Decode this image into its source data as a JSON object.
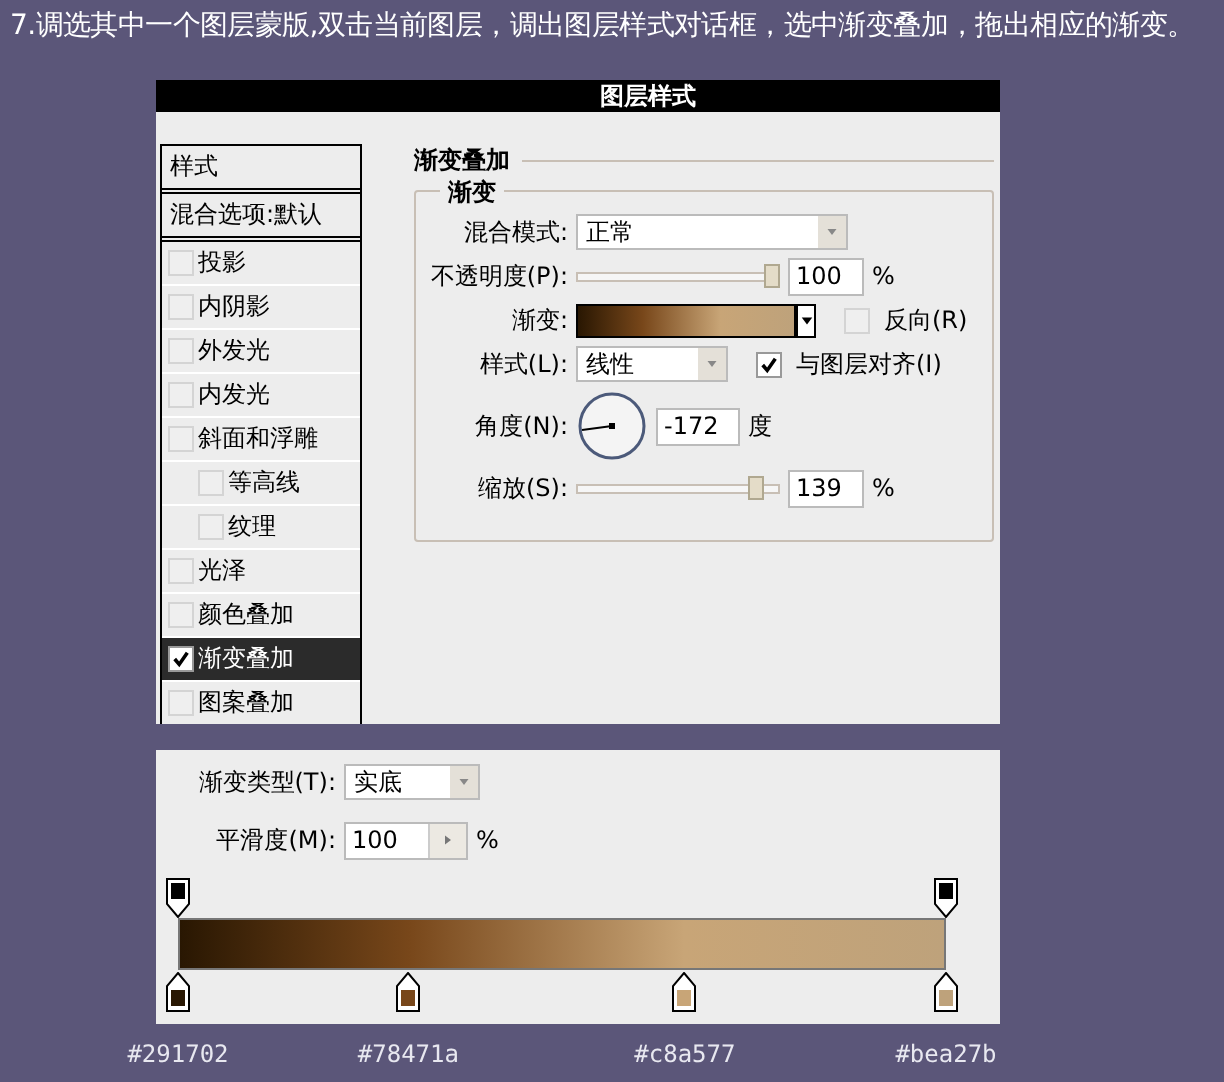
{
  "caption": "7.调选其中一个图层蒙版,双击当前图层，调出图层样式对话框，选中渐变叠加，拖出相应的渐变。",
  "dialog": {
    "title": "图层样式",
    "styles_list": [
      {
        "kind": "header",
        "label": "样式",
        "selected": false
      },
      {
        "kind": "header",
        "label": "混合选项:默认",
        "selected": false
      },
      {
        "kind": "check",
        "label": "投影",
        "checked": false,
        "selected": false
      },
      {
        "kind": "check",
        "label": "内阴影",
        "checked": false,
        "selected": false
      },
      {
        "kind": "check",
        "label": "外发光",
        "checked": false,
        "selected": false
      },
      {
        "kind": "check",
        "label": "内发光",
        "checked": false,
        "selected": false
      },
      {
        "kind": "check",
        "label": "斜面和浮雕",
        "checked": false,
        "selected": false,
        "children": [
          {
            "kind": "check",
            "label": "等高线",
            "checked": false,
            "selected": false
          },
          {
            "kind": "check",
            "label": "纹理",
            "checked": false,
            "selected": false
          }
        ]
      },
      {
        "kind": "check",
        "label": "光泽",
        "checked": false,
        "selected": false
      },
      {
        "kind": "check",
        "label": "颜色叠加",
        "checked": false,
        "selected": false
      },
      {
        "kind": "check",
        "label": "渐变叠加",
        "checked": true,
        "selected": true
      },
      {
        "kind": "check",
        "label": "图案叠加",
        "checked": false,
        "selected": false
      }
    ],
    "section_title": "渐变叠加",
    "group_title": "渐变",
    "blend_mode": {
      "label": "混合模式:",
      "value": "正常"
    },
    "opacity": {
      "label": "不透明度(P):",
      "level": 1,
      "value": "100",
      "unit": "%"
    },
    "gradient": {
      "label": "渐变:",
      "reverse": {
        "label": "反向(R)",
        "checked": false
      }
    },
    "style": {
      "label": "样式(L):",
      "value": "线性",
      "align": {
        "label": "与图层对齐(I)",
        "checked": true
      }
    },
    "angle": {
      "label": "角度(N):",
      "value": "-172",
      "unit": "度"
    },
    "scale": {
      "label": "缩放(S):",
      "level": 0.92,
      "value": "139",
      "unit": "%"
    }
  },
  "gradient_editor": {
    "type": {
      "label": "渐变类型(T):",
      "value": "实底"
    },
    "smoothness": {
      "label": "平滑度(M):",
      "value": "100",
      "unit": "%"
    },
    "opacity_stops": [
      {
        "level": 0
      },
      {
        "level": 1
      }
    ],
    "color_stops": [
      {
        "level": 0,
        "color": "#291702",
        "label": "#291702"
      },
      {
        "level": 0.3,
        "color": "#78471a",
        "label": "#78471a"
      },
      {
        "level": 0.66,
        "color": "#c8a577",
        "label": "#c8a577"
      },
      {
        "level": 1,
        "color": "#bea27b",
        "label": "#bea27b"
      }
    ]
  }
}
